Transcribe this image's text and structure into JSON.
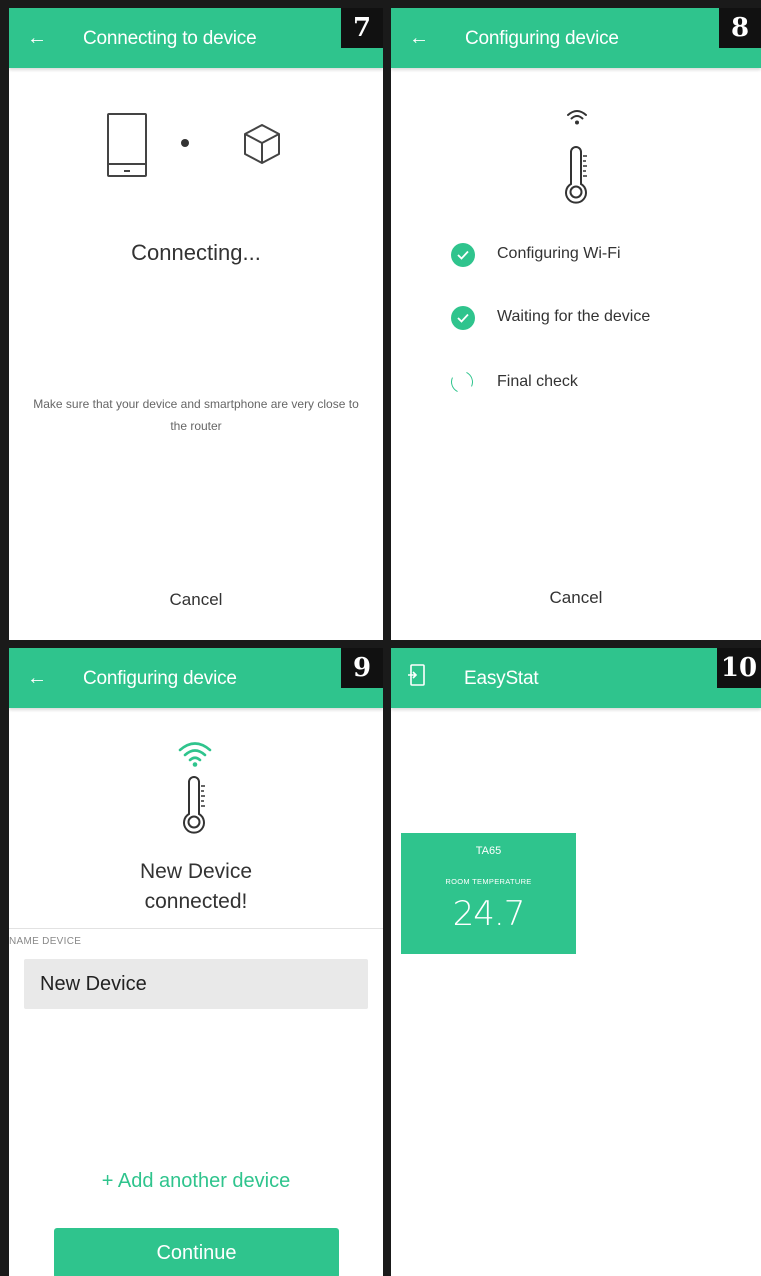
{
  "colors": {
    "accent": "#2fc48d",
    "badge_bg": "#111111",
    "separator": "#1a1a1a"
  },
  "panel7": {
    "badge": "7",
    "back_icon": "arrow-left-icon",
    "title": "Connecting to device",
    "status": "Connecting...",
    "hint": "Make sure that your device and smartphone are very close to the router",
    "cancel": "Cancel"
  },
  "panel8": {
    "badge": "8",
    "back_icon": "arrow-left-icon",
    "title": "Configuring device",
    "steps": [
      {
        "label": "Configuring Wi-Fi",
        "state": "done"
      },
      {
        "label": "Waiting for the device",
        "state": "done"
      },
      {
        "label": "Final check",
        "state": "in-progress"
      }
    ],
    "cancel": "Cancel"
  },
  "panel9": {
    "badge": "9",
    "back_icon": "arrow-left-icon",
    "title": "Configuring device",
    "message_line1": "New Device",
    "message_line2": "connected!",
    "field_label": "NAME DEVICE",
    "name_value": "New Device",
    "add_link": "+ Add another device",
    "continue": "Continue"
  },
  "panel10": {
    "badge": "10",
    "exit_icon": "exit-icon",
    "title": "EasyStat",
    "widget": {
      "name": "TA65",
      "label": "ROOM TEMPERATURE",
      "value": "24.7"
    }
  }
}
